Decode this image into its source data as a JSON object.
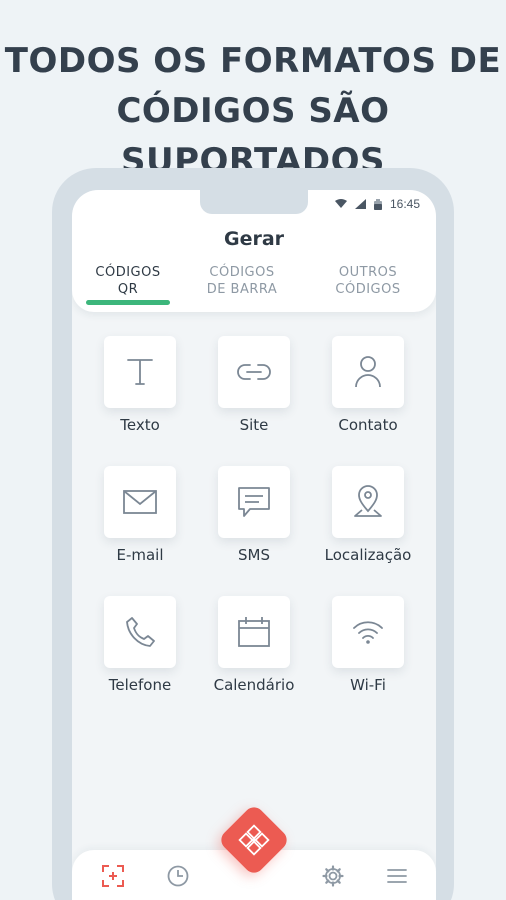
{
  "headline": {
    "line1": "TODOS OS FORMATOS DE",
    "line2": "CÓDIGOS SÃO SUPORTADOS"
  },
  "status_bar": {
    "time": "16:45",
    "icons": [
      "wifi-icon",
      "signal-icon",
      "battery-icon"
    ]
  },
  "app": {
    "title": "Gerar"
  },
  "tabs": [
    {
      "label": "CÓDIGOS\nQR",
      "active": true
    },
    {
      "label": "CÓDIGOS\nDE BARRA",
      "active": false
    },
    {
      "label": "OUTROS\nCÓDIGOS",
      "active": false
    }
  ],
  "grid": [
    {
      "label": "Texto",
      "icon": "text-icon"
    },
    {
      "label": "Site",
      "icon": "link-icon"
    },
    {
      "label": "Contato",
      "icon": "person-icon"
    },
    {
      "label": "E-mail",
      "icon": "mail-icon"
    },
    {
      "label": "SMS",
      "icon": "message-icon"
    },
    {
      "label": "Localização",
      "icon": "location-pin-icon"
    },
    {
      "label": "Telefone",
      "icon": "phone-icon"
    },
    {
      "label": "Calendário",
      "icon": "calendar-icon"
    },
    {
      "label": "Wi-Fi",
      "icon": "wifi-icon"
    }
  ],
  "bottom_nav": {
    "items": [
      "scan-icon",
      "history-icon",
      "generate-icon",
      "settings-icon",
      "menu-icon"
    ],
    "active": "scan-icon"
  },
  "colors": {
    "accent_green": "#3cb67b",
    "fab_red": "#ec5b52",
    "scan_active": "#ec5b52",
    "text_dark": "#2f3a45",
    "text_muted": "#8e99a4",
    "background": "#eef3f6"
  }
}
